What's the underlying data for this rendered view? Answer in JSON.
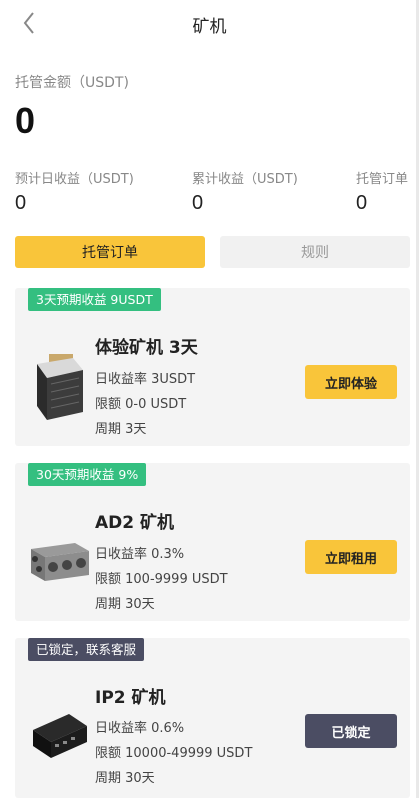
{
  "header": {
    "title": "矿机",
    "back_icon": "chevron-left-icon"
  },
  "summary": {
    "label": "托管金额（USDT)",
    "value": "0"
  },
  "stats": [
    {
      "label": "预计日收益（USDT)",
      "value": "0"
    },
    {
      "label": "累计收益（USDT)",
      "value": "0"
    },
    {
      "label": "托管订单",
      "value": "0"
    }
  ],
  "tabs": {
    "active": "托管订单",
    "inactive": "规则"
  },
  "cards": [
    {
      "tag": "3天预期收益 9USDT",
      "name": "体验矿机 3天",
      "rate": "日收益率 3USDT",
      "limit": "限额 0-0 USDT",
      "period": "周期 3天",
      "button": "立即体验"
    },
    {
      "tag": "30天预期收益 9%",
      "name": "AD2 矿机",
      "rate": "日收益率 0.3%",
      "limit": "限额 100-9999 USDT",
      "period": "周期 30天",
      "button": "立即租用"
    },
    {
      "tag": "已锁定，联系客服",
      "name": "IP2 矿机",
      "rate": "日收益率 0.6%",
      "limit": "限额 10000-49999 USDT",
      "period": "周期 30天",
      "button": "已锁定"
    }
  ],
  "colors": {
    "accent": "#f9c53a",
    "tag_green": "#34bf80",
    "locked": "#4b4d63"
  }
}
